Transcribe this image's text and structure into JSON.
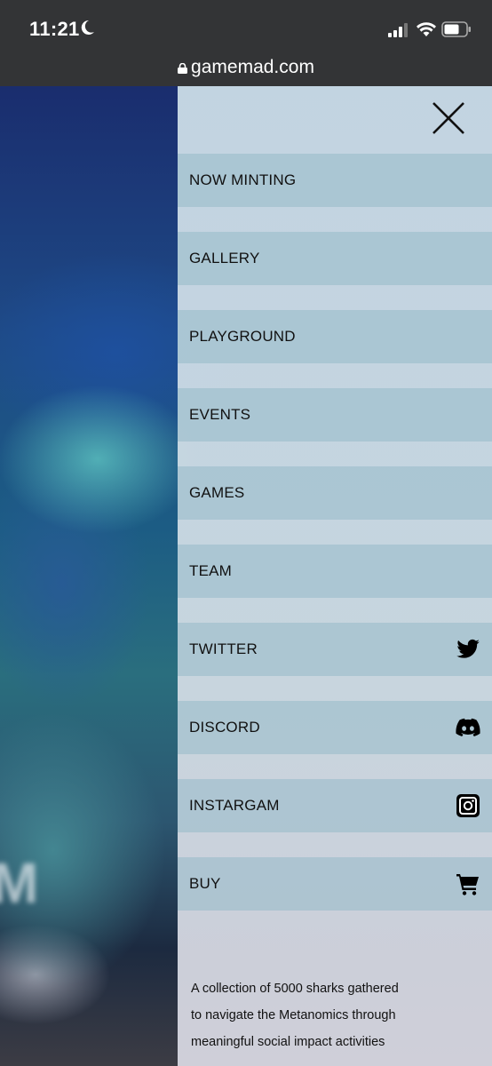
{
  "status_bar": {
    "time": "11:21"
  },
  "browser": {
    "url": "gamemad.com"
  },
  "menu": {
    "items": [
      {
        "label": "NOW MINTING",
        "icon": ""
      },
      {
        "label": "GALLERY",
        "icon": ""
      },
      {
        "label": "PLAYGROUND",
        "icon": ""
      },
      {
        "label": "EVENTS",
        "icon": ""
      },
      {
        "label": "GAMES",
        "icon": ""
      },
      {
        "label": "TEAM",
        "icon": ""
      },
      {
        "label": "TWITTER",
        "icon": "twitter-icon"
      },
      {
        "label": "DISCORD",
        "icon": "discord-icon"
      },
      {
        "label": "INSTARGAM",
        "icon": "instagram-icon"
      },
      {
        "label": "BUY",
        "icon": "cart-icon"
      }
    ],
    "description_lines": [
      "A collection of 5000 sharks gathered",
      "to navigate the  Metanomics through",
      "meaningful social impact activities"
    ]
  }
}
